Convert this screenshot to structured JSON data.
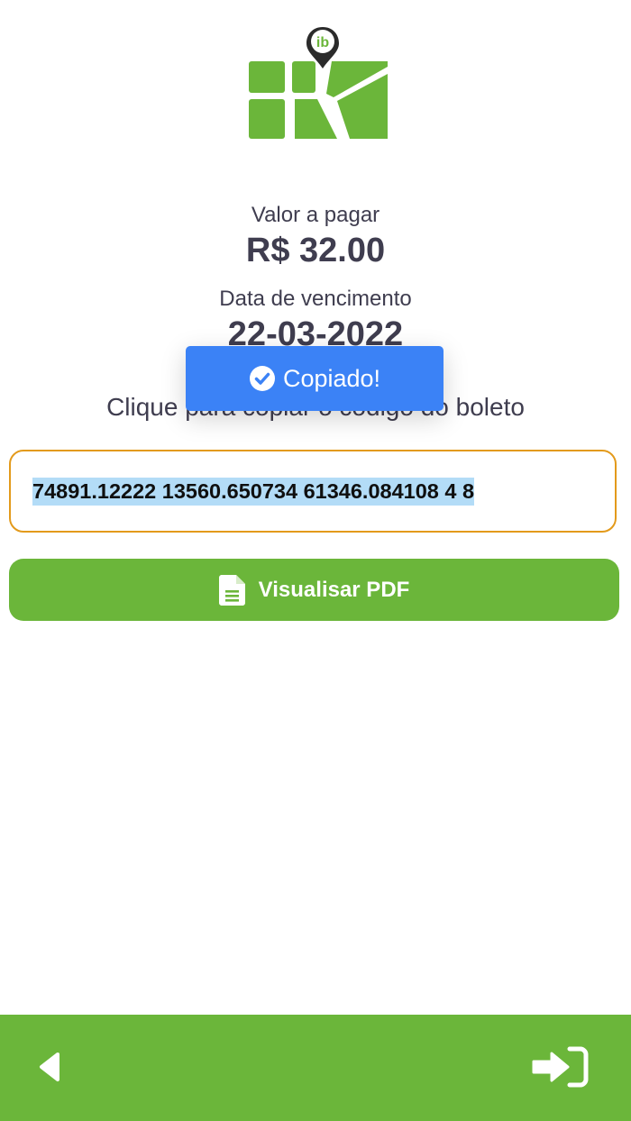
{
  "app": {
    "logo_badge_text": "ib",
    "brand_color": "#6bb63a"
  },
  "payment": {
    "amount_label": "Valor a pagar",
    "amount_value": "R$ 32.00",
    "due_label": "Data de vencimento",
    "due_value": "22-03-2022",
    "instruction": "Clique para copiar o código do boleto",
    "boleto_code": "74891.12222 13560.650734 61346.084108 4 8"
  },
  "toast": {
    "message": "Copiado!",
    "icon": "check-circle-icon",
    "color": "#3b82f6"
  },
  "actions": {
    "pdf_label": "Visualisar PDF",
    "pdf_icon": "file-text-icon"
  },
  "bottom_bar": {
    "back_icon": "back-arrow-icon",
    "login_icon": "sign-in-icon"
  }
}
